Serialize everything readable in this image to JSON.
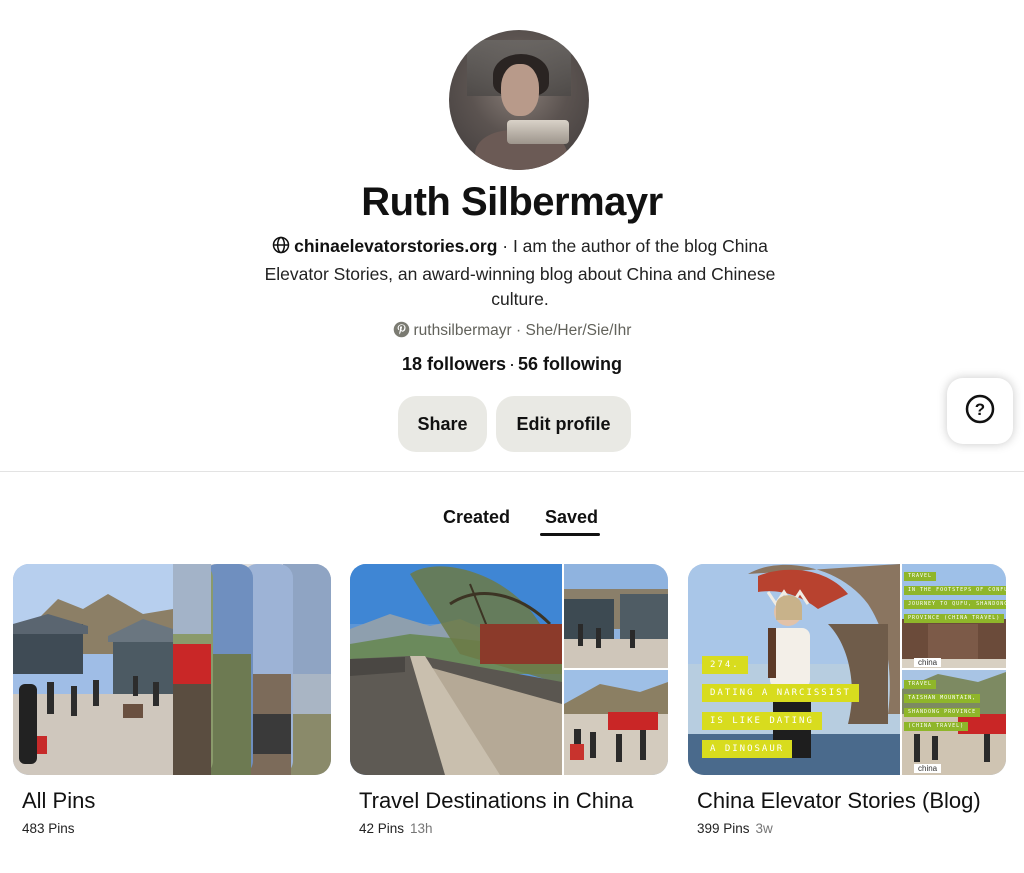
{
  "profile": {
    "name": "Ruth Silbermayr",
    "website": "chinaelevatorstories.org",
    "bio": " · I am the author of the blog China Elevator Stories, an award-winning blog about China and Chinese culture.",
    "username": "ruthsilbermayr",
    "pronouns": " · She/Her/Sie/Ihr",
    "followers": "18 followers",
    "following": "56 following"
  },
  "actions": {
    "share": "Share",
    "edit_profile": "Edit profile"
  },
  "tabs": [
    {
      "label": "Created",
      "active": false
    },
    {
      "label": "Saved",
      "active": true
    }
  ],
  "boards": [
    {
      "title": "All Pins",
      "pins": "483 Pins",
      "updated": ""
    },
    {
      "title": "Travel Destinations in China",
      "pins": "42 Pins",
      "updated": "13h"
    },
    {
      "title": "China Elevator Stories (Blog)",
      "pins": "399 Pins",
      "updated": "3w"
    }
  ],
  "board3_overlay": {
    "lines": [
      "274.",
      "DATING A NARCISSIST",
      "IS LIKE DATING",
      "A DINOSAUR"
    ],
    "mini_tags_top": [
      "TRAVEL",
      "IN THE FOOTSTEPS OF CONFUCIUS:",
      "JOURNEY TO QUFU, SHANDONG",
      "PROVINCE (CHINA TRAVEL)"
    ],
    "mini_tags_bottom": [
      "TRAVEL",
      "TAISHAN MOUNTAIN,",
      "SHANDONG PROVINCE",
      "(CHINA TRAVEL)"
    ],
    "mini_logo": "china"
  },
  "help_label": "?",
  "colors": {
    "button_bg": "#e9e9e4",
    "text": "#111111",
    "muted": "#62625b",
    "tag_yellow": "#d8dc1e",
    "tag_green": "#8fb62a"
  },
  "icons": [
    "globe-icon",
    "pinterest-icon",
    "help-icon"
  ]
}
